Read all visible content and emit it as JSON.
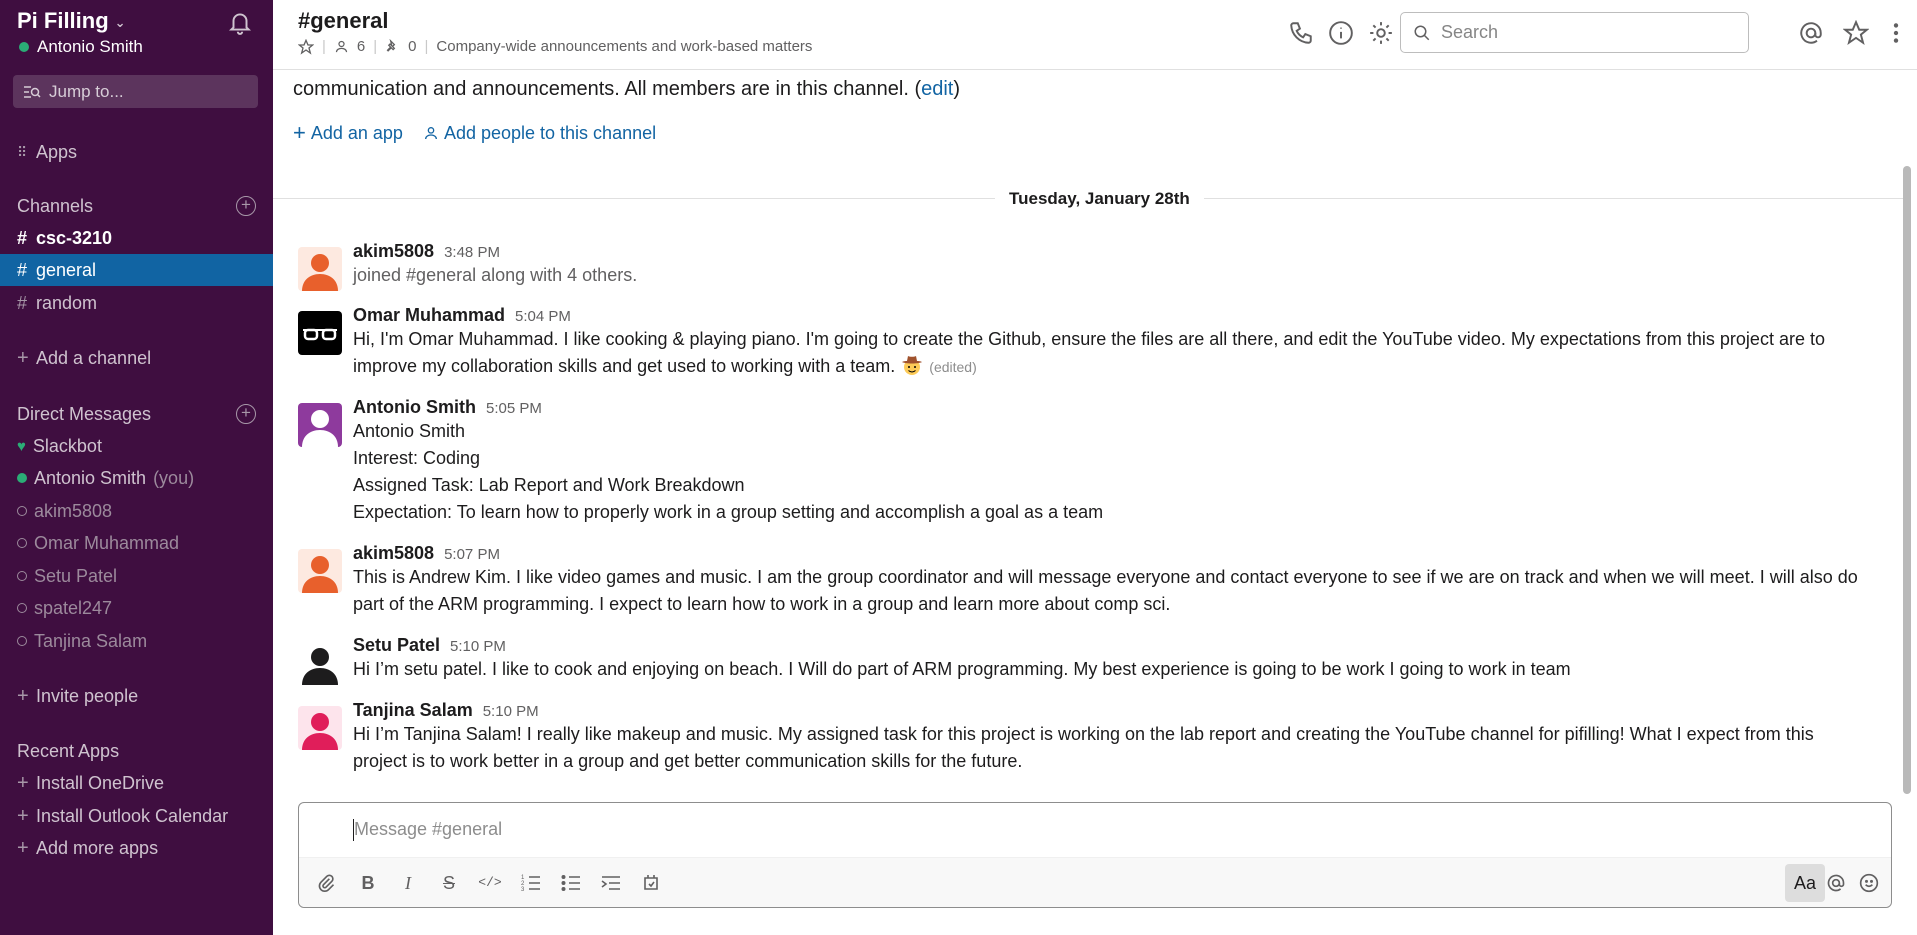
{
  "workspace": {
    "name": "Pi Filling",
    "user": "Antonio Smith"
  },
  "sidebar": {
    "jump_placeholder": "Jump to...",
    "apps_label": "Apps",
    "channels_header": "Channels",
    "channels": [
      {
        "name": "csc-3210",
        "state": "unread"
      },
      {
        "name": "general",
        "state": "active"
      },
      {
        "name": "random",
        "state": "normal"
      }
    ],
    "add_channel": "Add a channel",
    "dm_header": "Direct Messages",
    "dms": [
      {
        "name": "Slackbot",
        "status": "bot"
      },
      {
        "name": "Antonio Smith",
        "suffix": "(you)",
        "status": "online"
      },
      {
        "name": "akim5808",
        "status": "offline"
      },
      {
        "name": "Omar Muhammad",
        "status": "offline"
      },
      {
        "name": "Setu Patel",
        "status": "offline"
      },
      {
        "name": "spatel247",
        "status": "offline"
      },
      {
        "name": "Tanjina Salam",
        "status": "offline"
      }
    ],
    "invite_people": "Invite people",
    "recent_apps_header": "Recent Apps",
    "recent_apps": [
      "Install OneDrive",
      "Install Outlook Calendar",
      "Add more apps"
    ]
  },
  "header": {
    "channel": "#general",
    "members": "6",
    "pins": "0",
    "topic": "Company-wide announcements and work-based matters",
    "search_placeholder": "Search"
  },
  "intro": {
    "text": "communication and announcements. All members are in this channel. (",
    "edit_link": "edit",
    "text_end": ")",
    "add_app": "Add an app",
    "add_people": "Add people to this channel"
  },
  "day_label": "Tuesday, January 28th",
  "messages": [
    {
      "author": "akim5808",
      "time": "3:48 PM",
      "lines": [
        "joined #general along with 4 others."
      ],
      "avatar_color": "#e8602c"
    },
    {
      "author": "Omar Muhammad",
      "time": "5:04 PM",
      "lines": [
        "Hi, I'm Omar Muhammad. I like cooking & playing piano. I'm going to create the Github, ensure the files are all there, and edit the YouTube video. My expectations from this project are to",
        "improve my collaboration skills and get used to working with a team."
      ],
      "edited": "(edited)",
      "avatar_color": "#000000"
    },
    {
      "author": "Antonio Smith",
      "time": "5:05 PM",
      "lines": [
        "Antonio Smith",
        "Interest: Coding",
        "Assigned Task: Lab Report and Work Breakdown",
        "Expectation: To learn how to properly work in a group setting and accomplish a goal as a team"
      ],
      "avatar_color": "#8e3a9d"
    },
    {
      "author": "akim5808",
      "time": "5:07 PM",
      "lines": [
        "This is Andrew Kim. I like video games and music. I am the group coordinator and will message everyone and contact everyone to see if we are on track and when we will meet. I will also do",
        "part of the ARM programming. I expect to learn how to work in a group and learn more about comp sci."
      ],
      "avatar_color": "#e8602c"
    },
    {
      "author": "Setu Patel",
      "time": "5:10 PM",
      "lines": [
        "Hi I’m setu patel. I like to cook and enjoying on beach. I Will do part of ARM programming. My best experience is going to be work I going to work in team"
      ],
      "avatar_color": "#1d1c1d"
    },
    {
      "author": "Tanjina Salam",
      "time": "5:10 PM",
      "lines": [
        "Hi I’m Tanjina Salam! I really like makeup and music. My assigned task for this project is working on the lab report and creating the YouTube channel for pifilling! What I expect from this",
        "project is to work better in a group and get better communication skills for the future."
      ],
      "avatar_color": "#e01e5a"
    }
  ],
  "composer": {
    "placeholder": "Message #general",
    "aa_label": "Aa"
  },
  "colors": {
    "sidebar_bg": "#3f0e40",
    "active_item": "#1164a3",
    "link": "#1264a3",
    "online": "#2bac76"
  }
}
